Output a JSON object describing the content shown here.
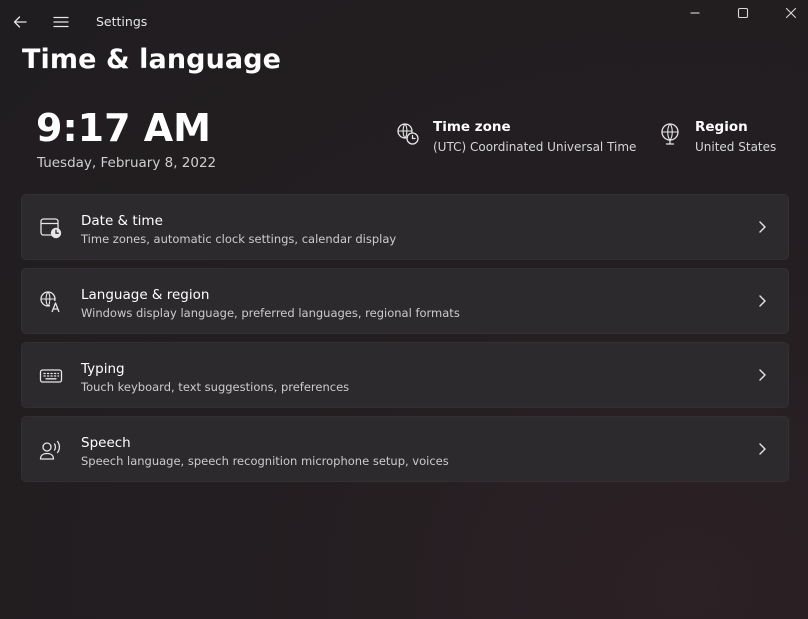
{
  "window": {
    "title": "Settings",
    "icons": {
      "back": "back-arrow-icon",
      "menu": "hamburger-menu-icon",
      "minimize": "minimize-icon",
      "maximize": "maximize-icon",
      "close": "close-icon"
    }
  },
  "page": {
    "title": "Time & language"
  },
  "clock": {
    "time": "9:17 AM",
    "date": "Tuesday, February 8, 2022"
  },
  "time_zone": {
    "label": "Time zone",
    "value": "(UTC) Coordinated Universal Time",
    "icon": "globe-clock-icon"
  },
  "region": {
    "label": "Region",
    "value": "United States",
    "icon": "globe-icon"
  },
  "cards": [
    {
      "title": "Date & time",
      "subtitle": "Time zones, automatic clock settings, calendar display",
      "icon": "calendar-clock-icon"
    },
    {
      "title": "Language & region",
      "subtitle": "Windows display language, preferred languages, regional formats",
      "icon": "language-icon"
    },
    {
      "title": "Typing",
      "subtitle": "Touch keyboard, text suggestions, preferences",
      "icon": "keyboard-icon"
    },
    {
      "title": "Speech",
      "subtitle": "Speech language, speech recognition microphone setup, voices",
      "icon": "speech-icon"
    }
  ],
  "colors": {
    "background": "#211d20",
    "card_background": "#2d2a2d",
    "text_primary": "#ffffff",
    "text_secondary": "#cccccc"
  }
}
